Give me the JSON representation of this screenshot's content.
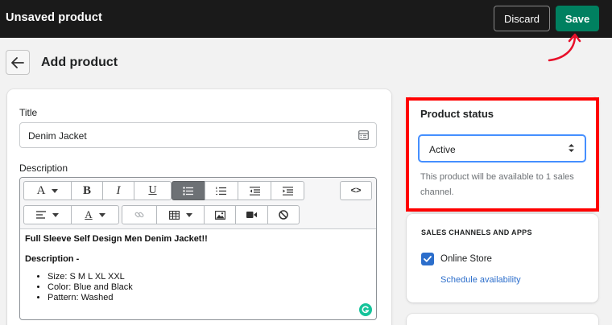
{
  "topbar": {
    "title": "Unsaved product",
    "discard_label": "Discard",
    "save_label": "Save"
  },
  "header": {
    "back_icon": "arrow-left-icon",
    "title": "Add product"
  },
  "form": {
    "title_label": "Title",
    "title_value": "Denim Jacket",
    "description_label": "Description",
    "toolbar": {
      "row1": [
        "font-A-dropdown",
        "bold",
        "italic",
        "underline",
        "bulleted-list",
        "numbered-list",
        "outdent",
        "indent",
        "source-code"
      ],
      "row2": [
        "align-dropdown",
        "text-color-dropdown",
        "link",
        "table-dropdown",
        "image",
        "video",
        "clear-format"
      ],
      "bold_label": "B",
      "italic_label": "I",
      "underline_label": "U",
      "code_label": "<>"
    },
    "content": {
      "heading": "Full Sleeve Self Design Men Denim Jacket!!",
      "subheading": "Description -",
      "bullets": [
        "Size: S M L XL XXL",
        "Color: Blue and Black",
        "Pattern: Washed"
      ]
    }
  },
  "status": {
    "title": "Product status",
    "selected": "Active",
    "help": "This product will be available to 1 sales channel."
  },
  "channels": {
    "heading": "SALES CHANNELS AND APPS",
    "items": [
      {
        "label": "Online Store",
        "checked": true
      }
    ],
    "schedule_link": "Schedule availability"
  },
  "colors": {
    "save": "#008060",
    "accent": "#2c6ecb",
    "highlight": "#ff0000",
    "topbar": "#1a1a1a"
  }
}
